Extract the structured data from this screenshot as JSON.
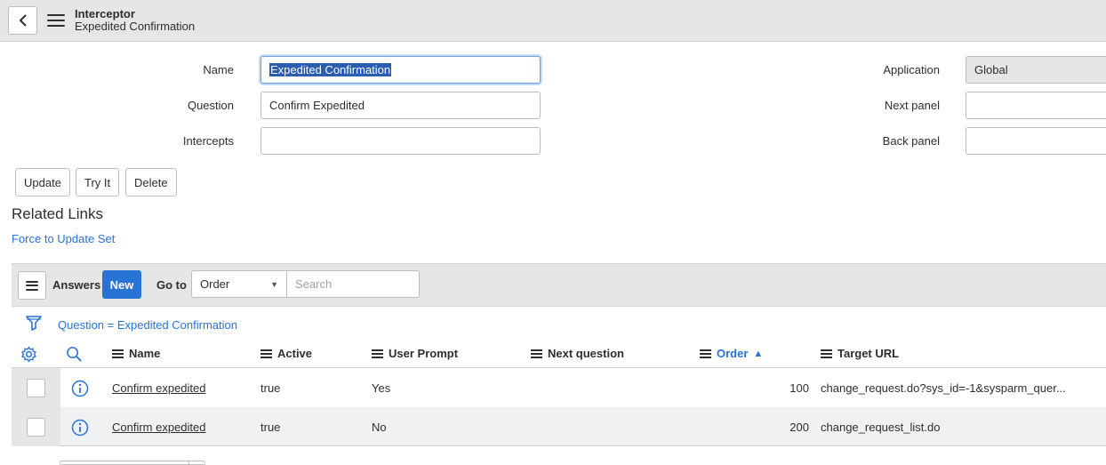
{
  "header": {
    "title": "Interceptor",
    "subtitle": "Expedited Confirmation"
  },
  "form": {
    "name_label": "Name",
    "name_value": "Expedited Confirmation",
    "question_label": "Question",
    "question_value": "Confirm Expedited",
    "intercepts_label": "Intercepts",
    "intercepts_value": "",
    "application_label": "Application",
    "application_value": "Global",
    "next_panel_label": "Next panel",
    "next_panel_value": "",
    "back_panel_label": "Back panel",
    "back_panel_value": ""
  },
  "actions": {
    "update": "Update",
    "try_it": "Try It",
    "delete": "Delete"
  },
  "related": {
    "heading": "Related Links",
    "link": "Force to Update Set"
  },
  "list": {
    "title": "Answers",
    "new_label": "New",
    "goto_label": "Go to",
    "goto_selected": "Order",
    "search_placeholder": "Search",
    "filter_text": "Question = Expedited Confirmation",
    "columns": [
      "Name",
      "Active",
      "User Prompt",
      "Next question",
      "Order",
      "Target URL"
    ],
    "sort_column": "Order",
    "sort_direction": "ascending",
    "rows": [
      {
        "name": "Confirm expedited",
        "active": "true",
        "user_prompt": "Yes",
        "next_question": "",
        "order": "100",
        "target_url": "change_request.do?sys_id=-1&sysparm_quer..."
      },
      {
        "name": "Confirm expedited",
        "active": "true",
        "user_prompt": "No",
        "next_question": "",
        "order": "200",
        "target_url": "change_request_list.do"
      }
    ]
  },
  "colors": {
    "accent": "#2873d6",
    "header_bg": "#e4e6e7",
    "selection": "#2a5db0"
  },
  "icons": [
    "chevron-left-icon",
    "hamburger-menu-icon",
    "filter-funnel-icon",
    "gear-icon",
    "search-icon",
    "info-icon",
    "sort-ascending-icon"
  ]
}
